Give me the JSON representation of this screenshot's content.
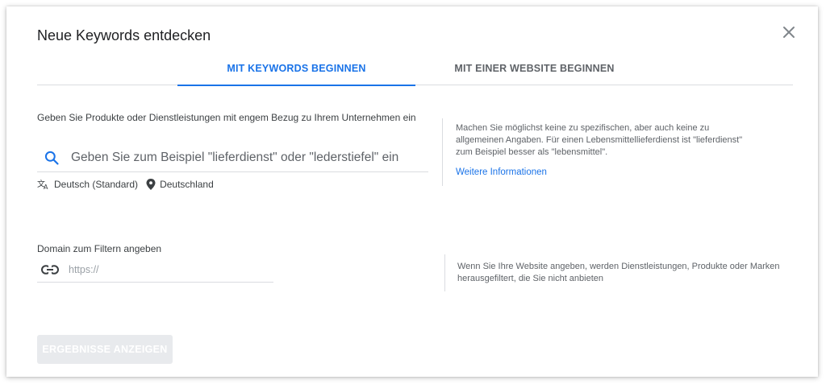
{
  "dialog": {
    "title": "Neue Keywords entdecken"
  },
  "tabs": [
    {
      "label": "MIT KEYWORDS BEGINNEN",
      "active": true
    },
    {
      "label": "MIT EINER WEBSITE BEGINNEN",
      "active": false
    }
  ],
  "keywords": {
    "label": "Geben Sie Produkte oder Dienstleistungen mit engem Bezug zu Ihrem Unternehmen ein",
    "placeholder": "Geben Sie zum Beispiel \"lieferdienst\" oder \"lederstiefel\" ein",
    "language": "Deutsch (Standard)",
    "location": "Deutschland",
    "help_text": "Machen Sie möglichst keine zu spezifischen, aber auch keine zu allgemeinen Angaben. Für einen Lebensmittellieferdienst ist \"lieferdienst\" zum Beispiel besser als \"lebensmittel\".",
    "more_info": "Weitere Informationen"
  },
  "domain": {
    "label": "Domain zum Filtern angeben",
    "placeholder": "https://",
    "help_text": "Wenn Sie Ihre Website angeben, werden Dienstleistungen, Produkte oder Marken herausgefiltert, die Sie nicht anbieten"
  },
  "actions": {
    "submit_label": "ERGEBNISSE ANZEIGEN"
  },
  "colors": {
    "accent": "#1a73e8",
    "disabled_button": "#e8eaed"
  },
  "icons": {
    "close": "close-icon",
    "search": "search-icon",
    "translate": "translate-icon",
    "location": "location-pin-icon",
    "link": "link-icon"
  }
}
